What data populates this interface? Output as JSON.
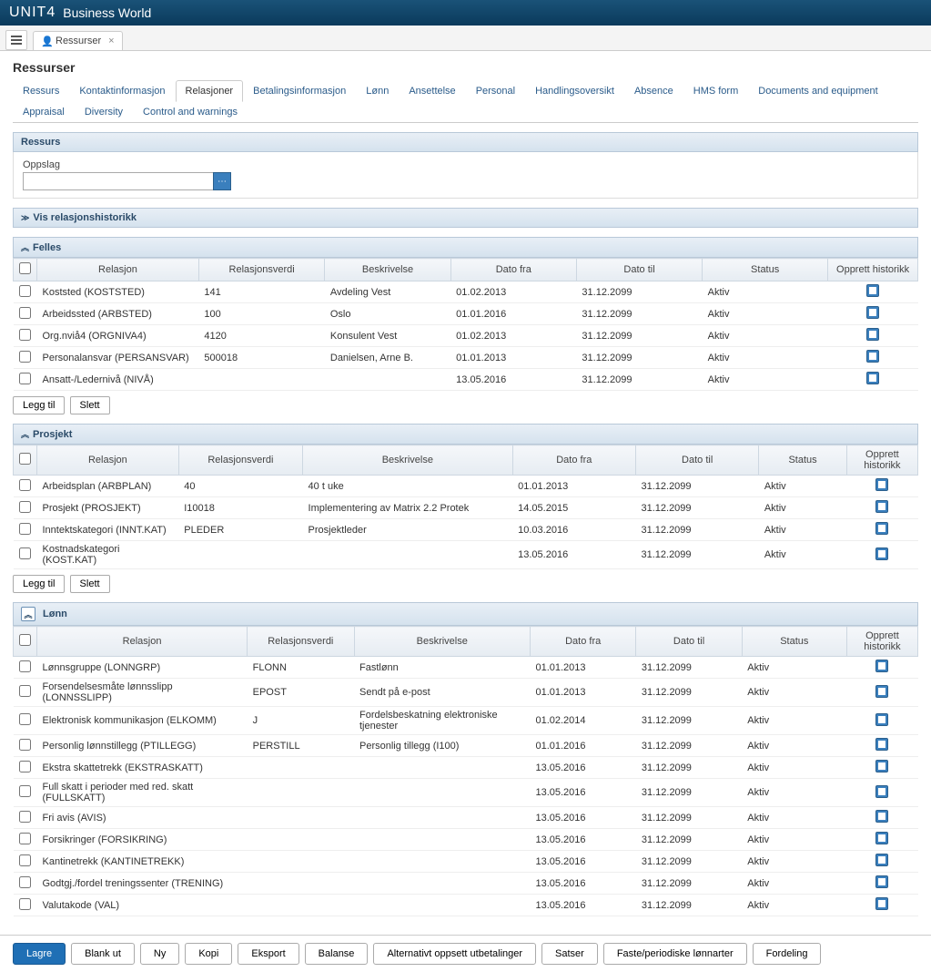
{
  "app": {
    "logo": "UNIT4",
    "title": "Business World"
  },
  "window_tab": {
    "label": "Ressurser"
  },
  "page_title": "Ressurser",
  "subtabs": [
    "Ressurs",
    "Kontaktinformasjon",
    "Relasjoner",
    "Betalingsinformasjon",
    "Lønn",
    "Ansettelse",
    "Personal",
    "Handlingsoversikt",
    "Absence",
    "HMS form",
    "Documents and equipment",
    "Appraisal",
    "Diversity",
    "Control and warnings"
  ],
  "subtab_active": 2,
  "ressurs_section": {
    "title": "Ressurs",
    "oppslag_label": "Oppslag",
    "oppslag_value": ""
  },
  "history_section": {
    "title": "Vis relasjonshistorikk"
  },
  "felles": {
    "title": "Felles",
    "headers": [
      "Relasjon",
      "Relasjonsverdi",
      "Beskrivelse",
      "Dato fra",
      "Dato til",
      "Status",
      "Opprett historikk"
    ],
    "rows": [
      {
        "rel": "Koststed (KOSTSTED)",
        "val": "141",
        "desc": "Avdeling Vest",
        "from": "01.02.2013",
        "to": "31.12.2099",
        "status": "Aktiv"
      },
      {
        "rel": "Arbeidssted (ARBSTED)",
        "val": "100",
        "desc": "Oslo",
        "from": "01.01.2016",
        "to": "31.12.2099",
        "status": "Aktiv"
      },
      {
        "rel": "Org.nviå4 (ORGNIVA4)",
        "val": "4120",
        "desc": "Konsulent Vest",
        "from": "01.02.2013",
        "to": "31.12.2099",
        "status": "Aktiv"
      },
      {
        "rel": "Personalansvar (PERSANSVAR)",
        "val": "500018",
        "desc": "Danielsen, Arne B.",
        "from": "01.01.2013",
        "to": "31.12.2099",
        "status": "Aktiv"
      },
      {
        "rel": "Ansatt-/Ledernivå (NIVÅ)",
        "val": "",
        "desc": "",
        "from": "13.05.2016",
        "to": "31.12.2099",
        "status": "Aktiv"
      }
    ]
  },
  "prosjekt": {
    "title": "Prosjekt",
    "headers": [
      "Relasjon",
      "Relasjonsverdi",
      "Beskrivelse",
      "Dato fra",
      "Dato til",
      "Status",
      "Opprett historikk"
    ],
    "rows": [
      {
        "rel": "Arbeidsplan (ARBPLAN)",
        "val": "40",
        "desc": "40 t uke",
        "from": "01.01.2013",
        "to": "31.12.2099",
        "status": "Aktiv"
      },
      {
        "rel": "Prosjekt (PROSJEKT)",
        "val": "I10018",
        "desc": "Implementering av Matrix 2.2 Protek",
        "from": "14.05.2015",
        "to": "31.12.2099",
        "status": "Aktiv"
      },
      {
        "rel": "Inntektskategori (INNT.KAT)",
        "val": "PLEDER",
        "desc": "Prosjektleder",
        "from": "10.03.2016",
        "to": "31.12.2099",
        "status": "Aktiv"
      },
      {
        "rel": "Kostnadskategori (KOST.KAT)",
        "val": "",
        "desc": "",
        "from": "13.05.2016",
        "to": "31.12.2099",
        "status": "Aktiv"
      }
    ]
  },
  "lonn": {
    "title": "Lønn",
    "headers": [
      "Relasjon",
      "Relasjonsverdi",
      "Beskrivelse",
      "Dato fra",
      "Dato til",
      "Status",
      "Opprett historikk"
    ],
    "rows": [
      {
        "rel": "Lønnsgruppe (LONNGRP)",
        "val": "FLONN",
        "desc": "Fastlønn",
        "from": "01.01.2013",
        "to": "31.12.2099",
        "status": "Aktiv"
      },
      {
        "rel": "Forsendelsesmåte lønnsslipp (LONNSSLIPP)",
        "val": "EPOST",
        "desc": "Sendt på e-post",
        "from": "01.01.2013",
        "to": "31.12.2099",
        "status": "Aktiv"
      },
      {
        "rel": "Elektronisk kommunikasjon (ELKOMM)",
        "val": "J",
        "desc": "Fordelsbeskatning elektroniske tjenester",
        "from": "01.02.2014",
        "to": "31.12.2099",
        "status": "Aktiv"
      },
      {
        "rel": "Personlig lønnstillegg (PTILLEGG)",
        "val": "PERSTILL",
        "desc": "Personlig tillegg (I100)",
        "from": "01.01.2016",
        "to": "31.12.2099",
        "status": "Aktiv"
      },
      {
        "rel": "Ekstra skattetrekk (EKSTRASKATT)",
        "val": "",
        "desc": "",
        "from": "13.05.2016",
        "to": "31.12.2099",
        "status": "Aktiv"
      },
      {
        "rel": "Full skatt i perioder med red. skatt (FULLSKATT)",
        "val": "",
        "desc": "",
        "from": "13.05.2016",
        "to": "31.12.2099",
        "status": "Aktiv"
      },
      {
        "rel": "Fri avis (AVIS)",
        "val": "",
        "desc": "",
        "from": "13.05.2016",
        "to": "31.12.2099",
        "status": "Aktiv"
      },
      {
        "rel": "Forsikringer (FORSIKRING)",
        "val": "",
        "desc": "",
        "from": "13.05.2016",
        "to": "31.12.2099",
        "status": "Aktiv"
      },
      {
        "rel": "Kantinetrekk (KANTINETREKK)",
        "val": "",
        "desc": "",
        "from": "13.05.2016",
        "to": "31.12.2099",
        "status": "Aktiv"
      },
      {
        "rel": "Godtgj./fordel treningssenter (TRENING)",
        "val": "",
        "desc": "",
        "from": "13.05.2016",
        "to": "31.12.2099",
        "status": "Aktiv"
      },
      {
        "rel": "Valutakode (VAL)",
        "val": "",
        "desc": "",
        "from": "13.05.2016",
        "to": "31.12.2099",
        "status": "Aktiv"
      }
    ]
  },
  "row_buttons": {
    "add": "Legg til",
    "delete": "Slett"
  },
  "footer": [
    "Lagre",
    "Blank ut",
    "Ny",
    "Kopi",
    "Eksport",
    "Balanse",
    "Alternativt oppsett utbetalinger",
    "Satser",
    "Faste/periodiske lønnarter",
    "Fordeling"
  ]
}
